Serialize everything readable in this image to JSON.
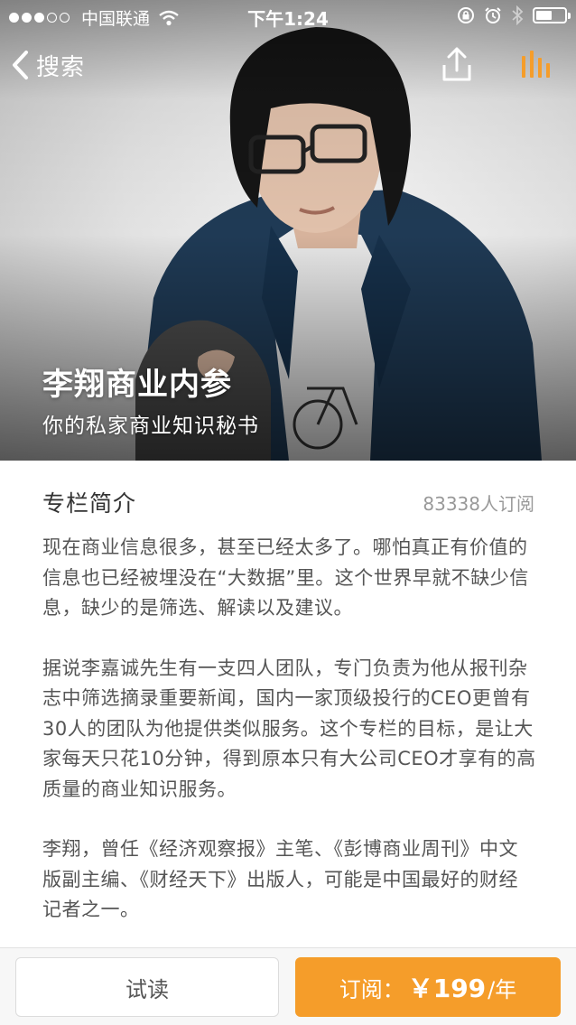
{
  "status_bar": {
    "carrier": "中国联通",
    "time": "下午1:24",
    "signal_strength": 3,
    "signal_total": 5,
    "battery_level": 0.55
  },
  "nav": {
    "back_label": "搜索"
  },
  "hero": {
    "title": "李翔商业内参",
    "subtitle": "你的私家商业知识秘书"
  },
  "section": {
    "title": "专栏简介",
    "subscriber_count": "83338人订阅"
  },
  "description": [
    "现在商业信息很多，甚至已经太多了。哪怕真正有价值的信息也已经被埋没在“大数据”里。这个世界早就不缺少信息，缺少的是筛选、解读以及建议。",
    "据说李嘉诚先生有一支四人团队，专门负责为他从报刊杂志中筛选摘录重要新闻，国内一家顶级投行的CEO更曾有30人的团队为他提供类似服务。这个专栏的目标，是让大家每天只花10分钟，得到原本只有大公司CEO才享有的高质量的商业知识服务。",
    "李翔，曾任《经济观察报》主笔、《彭博商业周刊》中文版副主编、《财经天下》出版人，可能是中国最好的财经记者之一。"
  ],
  "bottom_bar": {
    "trial_label": "试读",
    "subscribe_label": "订阅：",
    "price": "￥199",
    "price_unit": "/年"
  },
  "colors": {
    "accent": "#f59d2a",
    "text_primary": "#333333",
    "text_secondary": "#555555",
    "text_muted": "#999999"
  },
  "icons": {
    "back": "chevron-left-icon",
    "share": "share-icon",
    "audio": "audio-bars-icon",
    "wifi": "wifi-icon",
    "lock": "orientation-lock-icon",
    "alarm": "alarm-icon",
    "bluetooth": "bluetooth-icon",
    "battery": "battery-icon"
  }
}
